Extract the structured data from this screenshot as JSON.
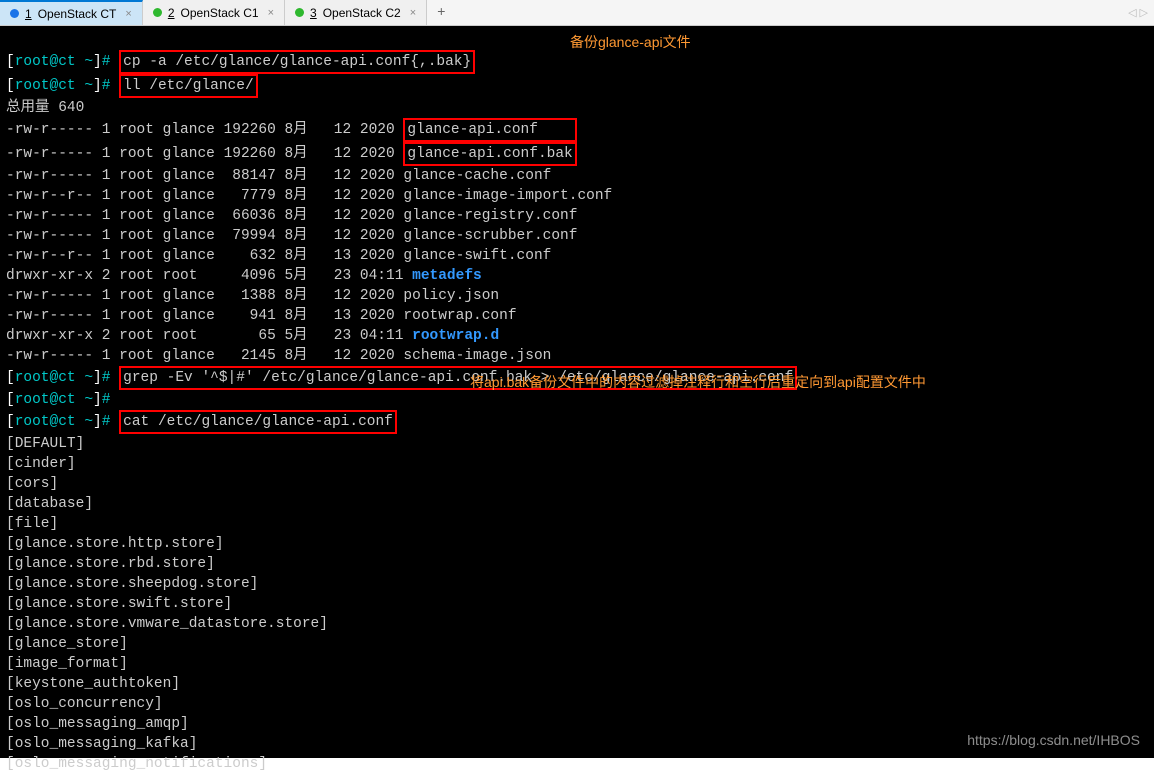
{
  "tabs": {
    "t1": {
      "num": "1",
      "label": "OpenStack CT"
    },
    "t2": {
      "num": "2",
      "label": "OpenStack C1"
    },
    "t3": {
      "num": "3",
      "label": "OpenStack C2"
    }
  },
  "add": "+",
  "prompt": {
    "user_host": "root@ct",
    "dir": "~",
    "hash": "#"
  },
  "cmd1": "cp -a /etc/glance/glance-api.conf{,.bak}",
  "cmd2": "ll /etc/glance/",
  "cmd3": "grep -Ev '^$|#' /etc/glance/glance-api.conf.bak > /etc/glance/glance-api.conf",
  "cmd4": "cat /etc/glance/glance-api.conf",
  "total": "总用量 640",
  "ls": {
    "r0": {
      "perm": "-rw-r-----",
      "lnk": "1",
      "own": "root",
      "grp": "glance",
      "size": "192260",
      "mon": "8月",
      "day": "12",
      "time": "2020",
      "name": "glance-api.conf"
    },
    "r1": {
      "perm": "-rw-r-----",
      "lnk": "1",
      "own": "root",
      "grp": "glance",
      "size": "192260",
      "mon": "8月",
      "day": "12",
      "time": "2020",
      "name": "glance-api.conf.bak"
    },
    "r2": {
      "perm": "-rw-r-----",
      "lnk": "1",
      "own": "root",
      "grp": "glance",
      "size": " 88147",
      "mon": "8月",
      "day": "12",
      "time": "2020",
      "name": "glance-cache.conf"
    },
    "r3": {
      "perm": "-rw-r--r--",
      "lnk": "1",
      "own": "root",
      "grp": "glance",
      "size": "  7779",
      "mon": "8月",
      "day": "12",
      "time": "2020",
      "name": "glance-image-import.conf"
    },
    "r4": {
      "perm": "-rw-r-----",
      "lnk": "1",
      "own": "root",
      "grp": "glance",
      "size": " 66036",
      "mon": "8月",
      "day": "12",
      "time": "2020",
      "name": "glance-registry.conf"
    },
    "r5": {
      "perm": "-rw-r-----",
      "lnk": "1",
      "own": "root",
      "grp": "glance",
      "size": " 79994",
      "mon": "8月",
      "day": "12",
      "time": "2020",
      "name": "glance-scrubber.conf"
    },
    "r6": {
      "perm": "-rw-r--r--",
      "lnk": "1",
      "own": "root",
      "grp": "glance",
      "size": "   632",
      "mon": "8月",
      "day": "13",
      "time": "2020",
      "name": "glance-swift.conf"
    },
    "r7": {
      "perm": "drwxr-xr-x",
      "lnk": "2",
      "own": "root",
      "grp": "root  ",
      "size": "  4096",
      "mon": "5月",
      "day": "23",
      "time": "04:11",
      "name": "metadefs"
    },
    "r8": {
      "perm": "-rw-r-----",
      "lnk": "1",
      "own": "root",
      "grp": "glance",
      "size": "  1388",
      "mon": "8月",
      "day": "12",
      "time": "2020",
      "name": "policy.json"
    },
    "r9": {
      "perm": "-rw-r-----",
      "lnk": "1",
      "own": "root",
      "grp": "glance",
      "size": "   941",
      "mon": "8月",
      "day": "13",
      "time": "2020",
      "name": "rootwrap.conf"
    },
    "r10": {
      "perm": "drwxr-xr-x",
      "lnk": "2",
      "own": "root",
      "grp": "root  ",
      "size": "    65",
      "mon": "5月",
      "day": "23",
      "time": "04:11",
      "name": "rootwrap.d"
    },
    "r11": {
      "perm": "-rw-r-----",
      "lnk": "1",
      "own": "root",
      "grp": "glance",
      "size": "  2145",
      "mon": "8月",
      "day": "12",
      "time": "2020",
      "name": "schema-image.json"
    }
  },
  "annot1": "备份glance-api文件",
  "annot2": "将api.bak备份文件中的内容过滤掉注释行和空行后重定向到api配置文件中",
  "cat": {
    "l0": "[DEFAULT]",
    "l1": "[cinder]",
    "l2": "[cors]",
    "l3": "[database]",
    "l4": "[file]",
    "l5": "[glance.store.http.store]",
    "l6": "[glance.store.rbd.store]",
    "l7": "[glance.store.sheepdog.store]",
    "l8": "[glance.store.swift.store]",
    "l9": "[glance.store.vmware_datastore.store]",
    "l10": "[glance_store]",
    "l11": "[image_format]",
    "l12": "[keystone_authtoken]",
    "l13": "[oslo_concurrency]",
    "l14": "[oslo_messaging_amqp]",
    "l15": "[oslo_messaging_kafka]",
    "l16": "[oslo_messaging_notifications]"
  },
  "watermark": "https://blog.csdn.net/IHBOS",
  "nav": {
    "left": "◁",
    "right": "▷"
  }
}
